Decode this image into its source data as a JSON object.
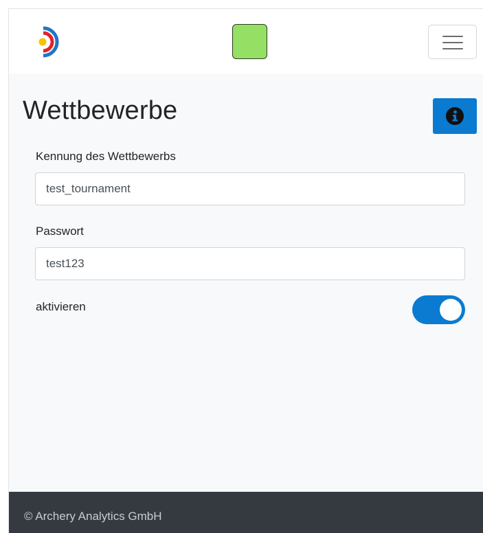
{
  "navbar": {
    "logo_icon": "archery-target-logo-icon",
    "status_color": "#95e064",
    "menu_icon": "hamburger-menu-icon"
  },
  "page": {
    "title": "Wettbewerbe",
    "info_icon": "info-circle-icon",
    "accent_color": "#0a7bd0"
  },
  "form": {
    "competition_id_label": "Kennung des Wettbewerbs",
    "competition_id_value": "test_tournament",
    "password_label": "Passwort",
    "password_value": "test123",
    "activate_label": "aktivieren",
    "activate_checked": true
  },
  "footer": {
    "copyright": "© Archery Analytics GmbH"
  }
}
